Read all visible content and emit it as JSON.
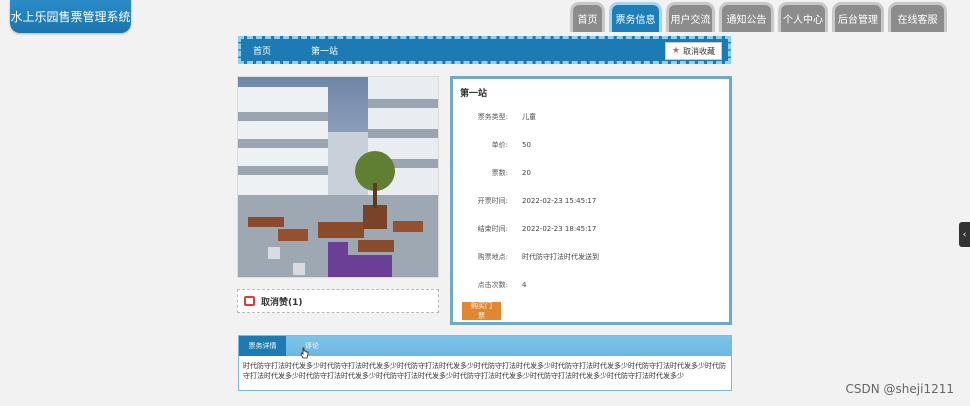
{
  "logo": {
    "text": "水上乐园售票管理系统"
  },
  "nav": {
    "items": [
      "首页",
      "票务信息",
      "用户交流",
      "通知公告",
      "个人中心",
      "后台管理",
      "在线客服"
    ]
  },
  "breadcrumb": {
    "home": "首页",
    "current": "第一站",
    "favorite_label": "取消收藏"
  },
  "like": {
    "label": "取消赞(1)"
  },
  "detail": {
    "title": "第一站",
    "rows": [
      {
        "label": "票务类型:",
        "value": "儿童"
      },
      {
        "label": "单价:",
        "value": "50"
      },
      {
        "label": "票数:",
        "value": "20"
      },
      {
        "label": "开票时间:",
        "value": "2022-02-23 15:45:17"
      },
      {
        "label": "结束时间:",
        "value": "2022-02-23 18:45:17"
      },
      {
        "label": "购票地点:",
        "value": "时代防守打法时代发送到"
      },
      {
        "label": "点击次数:",
        "value": "4"
      }
    ],
    "buy_button": "购买门票"
  },
  "tabs": {
    "items": [
      "票务详情",
      "评论"
    ],
    "content": "时代防守打法时代发多少时代防守打法时代发多少时代防守打法时代发多少时代防守打法时代发多少时代防守打法时代发多少时代防守打法时代发多少时代防守打法时代发多少时代防守打法时代发多少时代防守打法时代发多少时代防守打法时代发多少时代防守打法时代发多少时代防守打法时代发多少"
  },
  "side_tab": {
    "icon": "‹"
  },
  "watermark": "CSDN @sheji1211",
  "colors": {
    "primary": "#1c7bb3",
    "accent": "#e0872f",
    "nav_inactive": "#8c8c8c"
  }
}
